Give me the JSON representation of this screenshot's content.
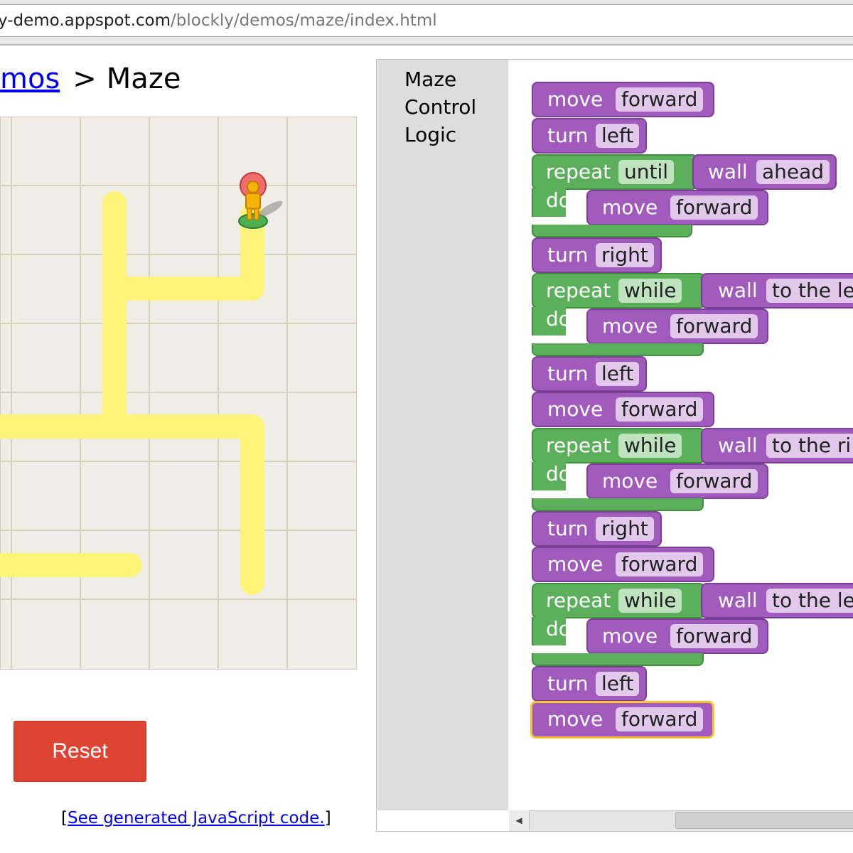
{
  "browser": {
    "url_host": "y-demo.appspot.com",
    "url_path": "/blockly/demos/maze/index.html"
  },
  "breadcrumb": {
    "link_text": "mos",
    "separator": ">",
    "current": "Maze"
  },
  "reset_label": "Reset",
  "code_link": {
    "open": "[",
    "text": "See generated JavaScript code.",
    "close": "]"
  },
  "toolbox": [
    "Maze",
    "Control",
    "Logic"
  ],
  "blocks": {
    "move": "move",
    "forward": "forward",
    "turn": "turn",
    "left": "left",
    "right": "right",
    "repeat": "repeat",
    "until": "until",
    "while": "while",
    "do": "do",
    "wall": "wall",
    "ahead": "ahead",
    "to_the_left": "to the le",
    "to_the_right": "to the ri"
  },
  "colors": {
    "move_block": "#a05bbd",
    "loop_block": "#5cb05c",
    "path": "#fff47a",
    "reset": "#dd4433",
    "selection": "#f6c231"
  }
}
